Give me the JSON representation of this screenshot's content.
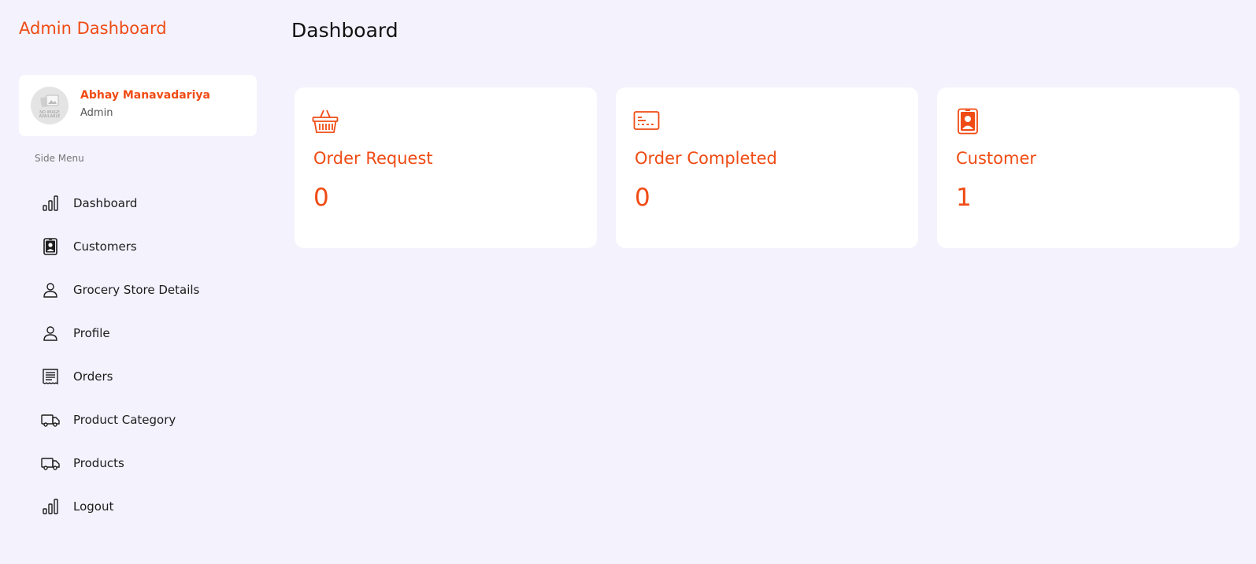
{
  "brand": {
    "title": "Admin Dashboard"
  },
  "user": {
    "name": "Abhay Manavadariya",
    "role": "Admin",
    "avatar_text": "NO IMAGE AVAILABLE"
  },
  "sidebar": {
    "heading": "Side Menu",
    "items": [
      {
        "label": "Dashboard",
        "icon": "bar-chart-icon"
      },
      {
        "label": "Customers",
        "icon": "id-badge-icon"
      },
      {
        "label": "Grocery Store Details",
        "icon": "user-icon"
      },
      {
        "label": "Profile",
        "icon": "user-icon"
      },
      {
        "label": "Orders",
        "icon": "receipt-icon"
      },
      {
        "label": "Product Category",
        "icon": "truck-icon"
      },
      {
        "label": "Products",
        "icon": "truck-icon"
      },
      {
        "label": "Logout",
        "icon": "bar-chart-icon"
      }
    ]
  },
  "main": {
    "title": "Dashboard",
    "cards": [
      {
        "title": "Order Request",
        "value": "0",
        "icon": "basket-icon"
      },
      {
        "title": "Order Completed",
        "value": "0",
        "icon": "credit-card-icon"
      },
      {
        "title": "Customer",
        "value": "1",
        "icon": "id-badge-icon"
      }
    ]
  },
  "colors": {
    "accent": "#f04b14",
    "background": "#f3f2fd",
    "card": "#ffffff"
  }
}
